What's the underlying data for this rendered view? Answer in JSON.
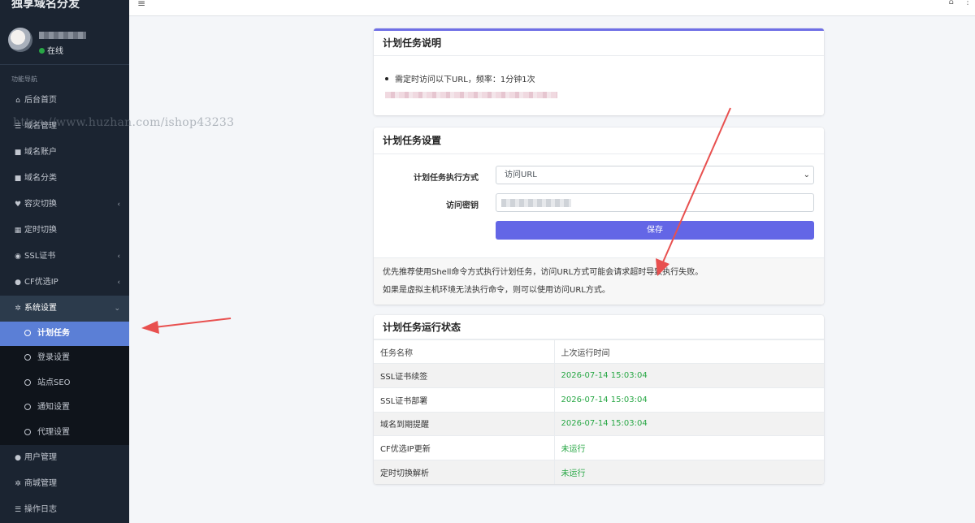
{
  "brand": {
    "title": "独享域名分发"
  },
  "user": {
    "status": "在线"
  },
  "sidebar": {
    "header": "功能导航",
    "items": [
      {
        "label": "后台首页",
        "icon": "home-icon",
        "glyph": "⌂",
        "chevron": ""
      },
      {
        "label": "域名管理",
        "icon": "list-icon",
        "glyph": "☰",
        "chevron": ""
      },
      {
        "label": "域名账户",
        "icon": "lock-icon",
        "glyph": "■",
        "chevron": ""
      },
      {
        "label": "域名分类",
        "icon": "folder-icon",
        "glyph": "■",
        "chevron": ""
      },
      {
        "label": "容灾切换",
        "icon": "heartbeat-icon",
        "glyph": "♥",
        "chevron": "‹"
      },
      {
        "label": "定时切换",
        "icon": "calendar-icon",
        "glyph": "▦",
        "chevron": ""
      },
      {
        "label": "SSL证书",
        "icon": "ssl-icon",
        "glyph": "◉",
        "chevron": "‹"
      },
      {
        "label": "CF优选IP",
        "icon": "globe-icon",
        "glyph": "●",
        "chevron": "‹"
      },
      {
        "label": "系统设置",
        "icon": "cogs-icon",
        "glyph": "✲",
        "chevron": "⌄"
      }
    ],
    "subitems": [
      {
        "label": "计划任务",
        "active": true
      },
      {
        "label": "登录设置"
      },
      {
        "label": "站点SEO"
      },
      {
        "label": "通知设置"
      },
      {
        "label": "代理设置"
      }
    ],
    "bottom_items": [
      {
        "label": "用户管理",
        "icon": "user-icon",
        "glyph": "●"
      },
      {
        "label": "商城管理",
        "icon": "gear-icon",
        "glyph": "✲"
      },
      {
        "label": "操作日志",
        "icon": "list-icon",
        "glyph": "☰"
      }
    ]
  },
  "topbar": {
    "menu_glyph": "≡",
    "home_glyph": "⌂",
    "more_glyph": "⋮"
  },
  "watermark": "https://www.huzhan.com/ishop43233",
  "info_card": {
    "title": "计划任务说明",
    "bullet": "需定时访问以下URL，频率：1分钟1次"
  },
  "settings_card": {
    "title": "计划任务设置",
    "mode_label": "计划任务执行方式",
    "mode_value": "访问URL",
    "key_label": "访问密钥",
    "save_label": "保存",
    "note1": "优先推荐使用Shell命令方式执行计划任务，访问URL方式可能会请求超时导致执行失败。",
    "note2": "如果是虚拟主机环境无法执行命令，则可以使用访问URL方式。"
  },
  "status_card": {
    "title": "计划任务运行状态",
    "columns": [
      "任务名称",
      "上次运行时间"
    ],
    "rows": [
      {
        "name": "SSL证书续签",
        "time": "2026-07-14 15:03:04"
      },
      {
        "name": "SSL证书部署",
        "time": "2026-07-14 15:03:04"
      },
      {
        "name": "域名到期提醒",
        "time": "2026-07-14 15:03:04"
      },
      {
        "name": "CF优选IP更新",
        "time": "未运行"
      },
      {
        "name": "定时切换解析",
        "time": "未运行"
      }
    ]
  },
  "colors": {
    "accent": "#6366e6",
    "sidebar_bg": "#1b2431",
    "active_item": "#5b7fd6",
    "success": "#28a745",
    "arrow": "#e8504f"
  }
}
